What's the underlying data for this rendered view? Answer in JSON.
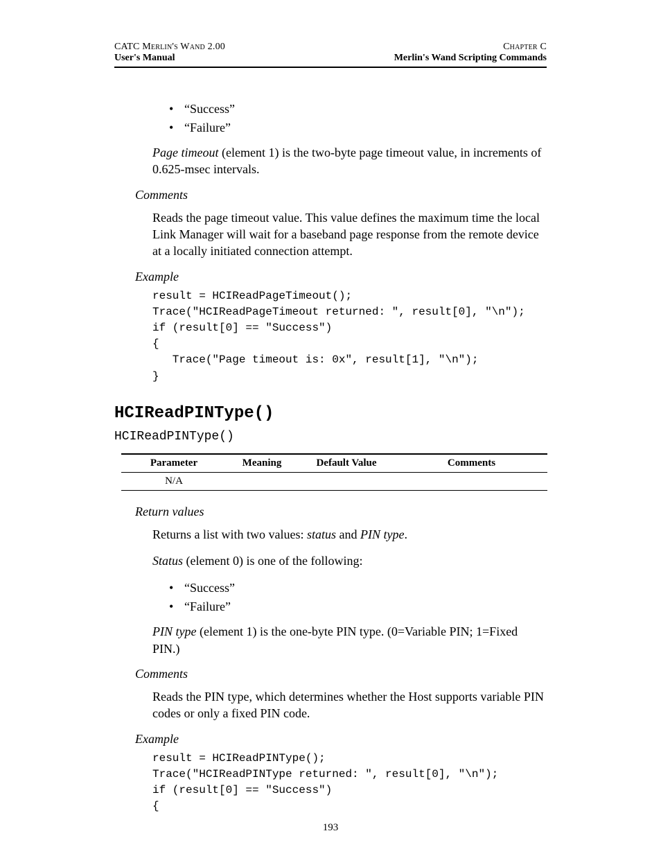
{
  "header": {
    "top_left": "CATC Merlin's Wand 2.00",
    "top_right": "Chapter C",
    "bottom_left": "User's Manual",
    "bottom_right": "Merlin's Wand Scripting Commands"
  },
  "section1": {
    "bullets": [
      "“Success”",
      "“Failure”"
    ],
    "page_timeout_label": "Page timeout",
    "page_timeout_rest": " (element 1) is the two-byte page timeout value, in increments of 0.625-msec intervals.",
    "comments_label": "Comments",
    "comments_text": "Reads the page timeout value. This value defines the maximum time the local Link Manager will wait for a baseband page response from the remote device at a locally initiated connection attempt.",
    "example_label": "Example",
    "example_code": "result = HCIReadPageTimeout();\nTrace(\"HCIReadPageTimeout returned: \", result[0], \"\\n\");\nif (result[0] == \"Success\")\n{\n   Trace(\"Page timeout is: 0x\", result[1], \"\\n\");\n}"
  },
  "section2": {
    "heading": "HCIReadPINType()",
    "signature": "HCIReadPINType()",
    "table": {
      "headers": [
        "Parameter",
        "Meaning",
        "Default Value",
        "Comments"
      ],
      "rows": [
        [
          "N/A",
          "",
          "",
          ""
        ]
      ]
    },
    "return_label": "Return values",
    "return_intro_pre": "Returns a list with two values: ",
    "return_intro_i1": "status",
    "return_intro_mid": " and ",
    "return_intro_i2": "PIN type",
    "return_intro_post": ".",
    "status_label": "Status",
    "status_rest": " (element 0) is one of the following:",
    "bullets": [
      "“Success”",
      "“Failure”"
    ],
    "pin_label": "PIN type",
    "pin_rest": " (element 1) is the one-byte PIN type. (0=Variable PIN; 1=Fixed PIN.)",
    "comments_label": "Comments",
    "comments_text": "Reads the PIN type, which determines whether the Host supports variable PIN codes or only a fixed PIN code.",
    "example_label": "Example",
    "example_code": "result = HCIReadPINType();\nTrace(\"HCIReadPINType returned: \", result[0], \"\\n\");\nif (result[0] == \"Success\")\n{"
  },
  "page_number": "193"
}
